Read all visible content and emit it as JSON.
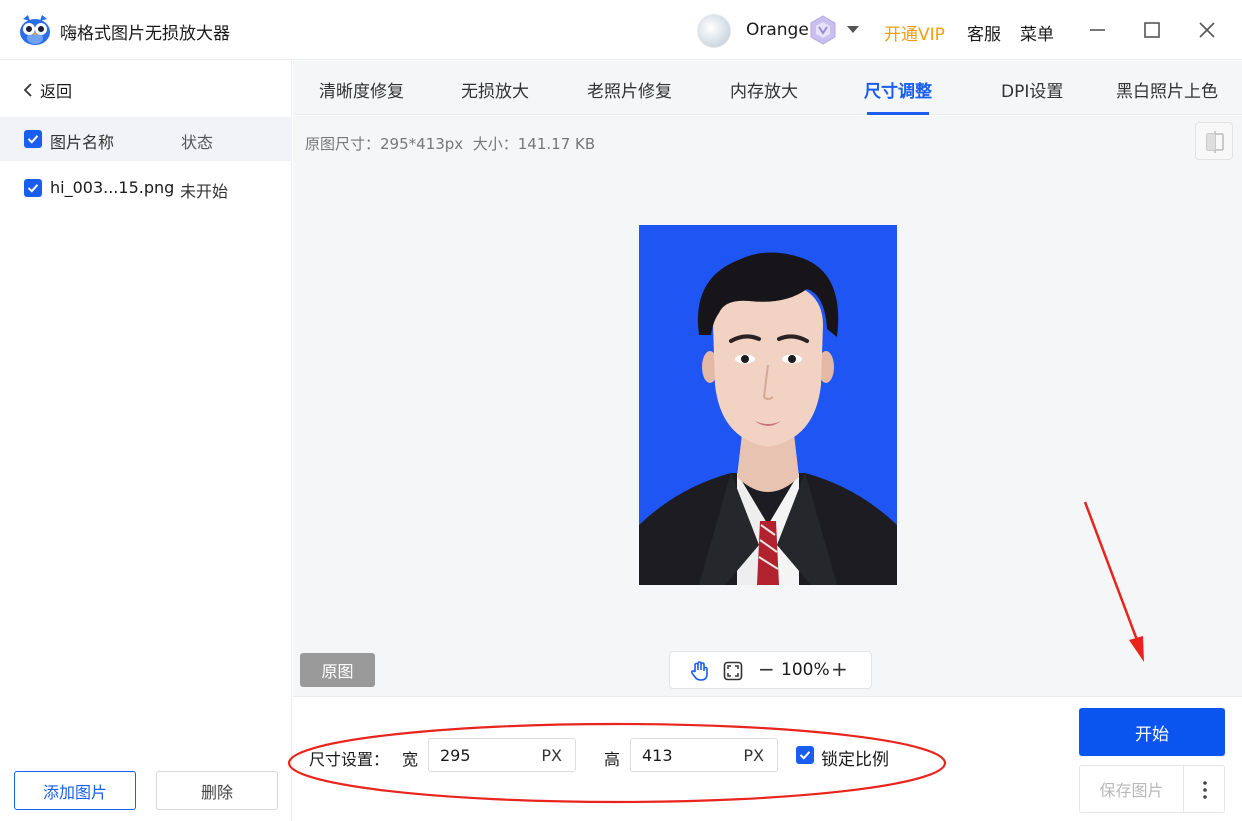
{
  "app": {
    "title": "嗨格式图片无损放大器",
    "username": "Orange",
    "vip_label": "开通VIP",
    "service_label": "客服",
    "menu_label": "菜单"
  },
  "sidebar": {
    "back_label": "返回",
    "header_name": "图片名称",
    "header_status": "状态",
    "files": [
      {
        "name": "hi_003...15.png",
        "status": "未开始"
      }
    ],
    "add_label": "添加图片",
    "delete_label": "删除"
  },
  "tabs": [
    {
      "label": "清晰度修复"
    },
    {
      "label": "无损放大"
    },
    {
      "label": "老照片修复"
    },
    {
      "label": "内存放大"
    },
    {
      "label": "尺寸调整"
    },
    {
      "label": "DPI设置"
    },
    {
      "label": "黑白照片上色"
    }
  ],
  "active_tab": "尺寸调整",
  "preview": {
    "original_size_label": "原图尺寸：",
    "original_size": "295*413px",
    "file_size_label": "大小：",
    "file_size": "141.17 KB",
    "original_button": "原图",
    "zoom_level": "100%"
  },
  "settings": {
    "size_label": "尺寸设置：",
    "width_label": "宽",
    "width_value": "295",
    "height_label": "高",
    "height_value": "413",
    "unit": "PX",
    "lock_ratio_label": "锁定比例",
    "lock_ratio_checked": true,
    "start_button": "开始",
    "save_button": "保存图片"
  },
  "colors": {
    "accent": "#1a5ef0",
    "vip": "#f59e0b",
    "photo_background": "#1f55f3",
    "annotation": "#e8241c"
  }
}
